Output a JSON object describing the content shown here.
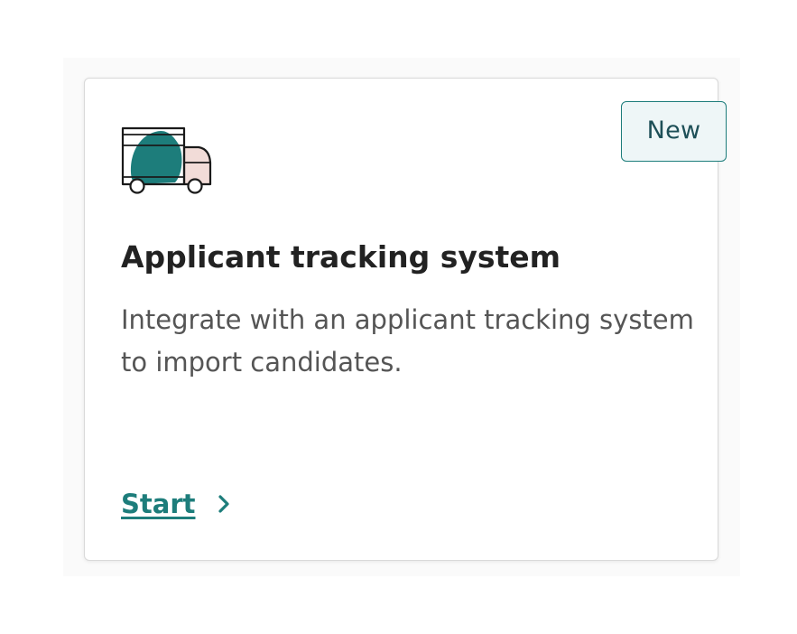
{
  "card": {
    "badge": "New",
    "icon": "delivery-truck-icon",
    "title": "Applicant tracking system",
    "description": "Integrate with an applicant tracking system to import candidates.",
    "cta": {
      "label": "Start",
      "icon": "chevron-right-icon"
    }
  },
  "colors": {
    "accent": "#1d7d7b",
    "badge_bg": "#eef6f7",
    "truck_cab": "#f2dcd8",
    "title_text": "#222222",
    "body_text": "#555555"
  }
}
